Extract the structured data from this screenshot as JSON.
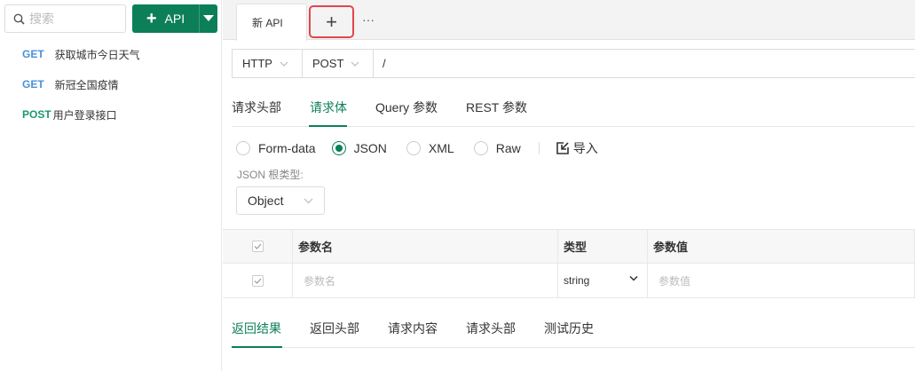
{
  "sidebar": {
    "search_placeholder": "搜索",
    "add_button_label": "API",
    "items": [
      {
        "method": "GET",
        "name": "获取城市今日天气"
      },
      {
        "method": "GET",
        "name": "新冠全国疫情"
      },
      {
        "method": "POST",
        "name": "用户登录接口"
      }
    ]
  },
  "tabs": {
    "items": [
      "新 API"
    ],
    "new_tab_symbol": "+",
    "more_symbol": "···"
  },
  "request": {
    "protocol": "HTTP",
    "method": "POST",
    "path": "/"
  },
  "subtabs": [
    "请求头部",
    "请求体",
    "Query 参数",
    "REST 参数"
  ],
  "body": {
    "formats": [
      "Form-data",
      "JSON",
      "XML",
      "Raw"
    ],
    "selected_format": "JSON",
    "import_label": "导入",
    "root_type_label": "JSON 根类型:",
    "root_type_value": "Object"
  },
  "params_table": {
    "headers": [
      "参数名",
      "类型",
      "参数值"
    ],
    "row": {
      "name_placeholder": "参数名",
      "type": "string",
      "value_placeholder": "参数值"
    }
  },
  "response_tabs": [
    "返回结果",
    "返回头部",
    "请求内容",
    "请求头部",
    "测试历史"
  ],
  "colors": {
    "accent": "#0c7f58",
    "get": "#4a90d9",
    "post": "#1a9a6c",
    "highlight_border": "#e0474c"
  }
}
